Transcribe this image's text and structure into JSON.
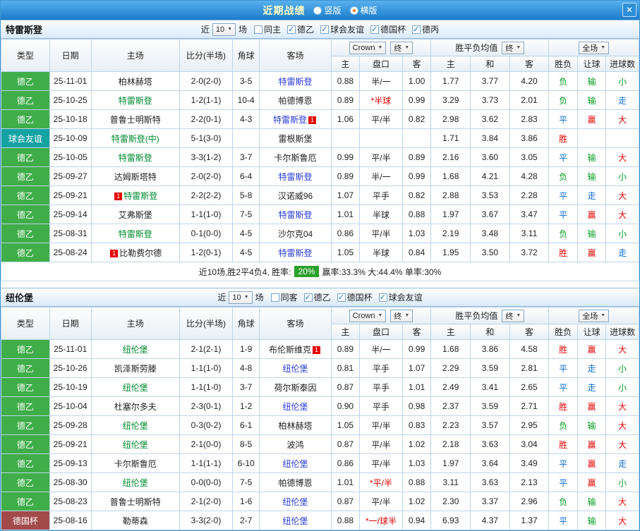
{
  "titlebar": {
    "title": "近期战绩",
    "close": "✕",
    "radios": [
      {
        "label": "竖版",
        "selected": false
      },
      {
        "label": "横版",
        "selected": true
      }
    ]
  },
  "columns": {
    "type": "类型",
    "date": "日期",
    "home": "主场",
    "score": "比分(半场)",
    "corner": "角球",
    "away": "客场",
    "book_select": "Crown",
    "final_select": "终",
    "asia_home": "主",
    "asia_handicap": "盘口",
    "asia_away": "客",
    "europe_label": "胜平负均值",
    "eu_home": "主",
    "eu_draw": "和",
    "eu_away": "客",
    "scope_select": "全场",
    "res_wdl": "胜负",
    "res_handicap": "让球",
    "res_goals": "进球数"
  },
  "sections": [
    {
      "team": "特雷斯登",
      "filter": {
        "prefix": "近",
        "count": "10",
        "suffix": "场",
        "checks": [
          {
            "label": "同主",
            "checked": false
          },
          {
            "label": "德乙",
            "checked": true
          },
          {
            "label": "球会友谊",
            "checked": true
          },
          {
            "label": "德国杯",
            "checked": true
          },
          {
            "label": "德丙",
            "checked": true
          }
        ]
      },
      "rows": [
        {
          "type": "德乙",
          "type_color": "bg-green",
          "date": "25-11-01",
          "home": "柏林赫塔",
          "home_color": "c-dark",
          "home_badge": "",
          "score": "2-0(2-0)",
          "corner": "3-5",
          "away": "特雷斯登",
          "away_color": "c-away",
          "away_badge": "",
          "a1": "0.88",
          "ah": "半/一",
          "ah_color": "",
          "a2": "1.00",
          "e1": "1.77",
          "e2": "3.77",
          "e3": "4.20",
          "r1": "负",
          "r1c": "c-green",
          "r2": "输",
          "r2c": "c-green",
          "r3": "小",
          "r3c": "c-green"
        },
        {
          "type": "德乙",
          "type_color": "bg-green",
          "date": "25-10-25",
          "home": "特雷斯登",
          "home_color": "c-home",
          "home_badge": "",
          "score": "1-2(1-1)",
          "corner": "10-4",
          "away": "帕德博恩",
          "away_color": "c-dark",
          "away_badge": "",
          "a1": "0.89",
          "ah": "*半球",
          "ah_color": "c-red",
          "a2": "0.99",
          "e1": "3.29",
          "e2": "3.73",
          "e3": "2.01",
          "r1": "负",
          "r1c": "c-green",
          "r2": "输",
          "r2c": "c-green",
          "r3": "走",
          "r3c": "c-blue"
        },
        {
          "type": "德乙",
          "type_color": "bg-green",
          "date": "25-10-18",
          "home": "普鲁士明斯特",
          "home_color": "c-dark",
          "home_badge": "",
          "score": "2-2(0-1)",
          "corner": "4-3",
          "away": "特雷斯登",
          "away_color": "c-away",
          "away_badge": "1",
          "a1": "1.06",
          "ah": "平/半",
          "ah_color": "",
          "a2": "0.82",
          "e1": "2.98",
          "e2": "3.62",
          "e3": "2.83",
          "r1": "平",
          "r1c": "c-blue",
          "r2": "赢",
          "r2c": "c-red",
          "r3": "大",
          "r3c": "c-red"
        },
        {
          "type": "球会友谊",
          "type_color": "bg-teal",
          "date": "25-10-09",
          "home": "特雷斯登(中)",
          "home_color": "c-home",
          "home_badge": "",
          "score": "5-1(3-0)",
          "corner": "",
          "away": "雷根斯堡",
          "away_color": "c-dark",
          "away_badge": "",
          "a1": "",
          "ah": "",
          "ah_color": "",
          "a2": "",
          "e1": "1.71",
          "e2": "3.84",
          "e3": "3.86",
          "r1": "胜",
          "r1c": "c-red",
          "r2": "",
          "r2c": "",
          "r3": "",
          "r3c": ""
        },
        {
          "type": "德乙",
          "type_color": "bg-green",
          "date": "25-10-05",
          "home": "特雷斯登",
          "home_color": "c-home",
          "home_badge": "",
          "score": "3-3(1-2)",
          "corner": "3-7",
          "away": "卡尔斯鲁厄",
          "away_color": "c-dark",
          "away_badge": "",
          "a1": "0.99",
          "ah": "平/半",
          "ah_color": "",
          "a2": "0.89",
          "e1": "2.16",
          "e2": "3.60",
          "e3": "3.05",
          "r1": "平",
          "r1c": "c-blue",
          "r2": "输",
          "r2c": "c-green",
          "r3": "大",
          "r3c": "c-red"
        },
        {
          "type": "德乙",
          "type_color": "bg-green",
          "date": "25-09-27",
          "home": "达姆斯塔特",
          "home_color": "c-dark",
          "home_badge": "",
          "score": "2-0(2-0)",
          "corner": "6-4",
          "away": "特雷斯登",
          "away_color": "c-away",
          "away_badge": "",
          "a1": "0.89",
          "ah": "半/一",
          "ah_color": "",
          "a2": "0.99",
          "e1": "1.68",
          "e2": "4.21",
          "e3": "4.28",
          "r1": "负",
          "r1c": "c-green",
          "r2": "输",
          "r2c": "c-green",
          "r3": "小",
          "r3c": "c-green"
        },
        {
          "type": "德乙",
          "type_color": "bg-green",
          "date": "25-09-21",
          "home": "特雷斯登",
          "home_color": "c-home",
          "home_badge": "1",
          "score": "2-2(2-2)",
          "corner": "5-8",
          "away": "汉诺威96",
          "away_color": "c-dark",
          "away_badge": "",
          "a1": "1.07",
          "ah": "平手",
          "ah_color": "",
          "a2": "0.82",
          "e1": "2.88",
          "e2": "3.53",
          "e3": "2.28",
          "r1": "平",
          "r1c": "c-blue",
          "r2": "走",
          "r2c": "c-blue",
          "r3": "大",
          "r3c": "c-red"
        },
        {
          "type": "德乙",
          "type_color": "bg-green",
          "date": "25-09-14",
          "home": "艾弗斯堡",
          "home_color": "c-dark",
          "home_badge": "",
          "score": "1-1(1-0)",
          "corner": "7-5",
          "away": "特雷斯登",
          "away_color": "c-away",
          "away_badge": "",
          "a1": "1.01",
          "ah": "半球",
          "ah_color": "",
          "a2": "0.88",
          "e1": "1.97",
          "e2": "3.67",
          "e3": "3.47",
          "r1": "平",
          "r1c": "c-blue",
          "r2": "赢",
          "r2c": "c-red",
          "r3": "大",
          "r3c": "c-red"
        },
        {
          "type": "德乙",
          "type_color": "bg-green",
          "date": "25-08-31",
          "home": "特雷斯登",
          "home_color": "c-home",
          "home_badge": "",
          "score": "0-1(0-0)",
          "corner": "4-5",
          "away": "沙尔克04",
          "away_color": "c-dark",
          "away_badge": "",
          "a1": "0.86",
          "ah": "平/半",
          "ah_color": "",
          "a2": "1.03",
          "e1": "2.19",
          "e2": "3.48",
          "e3": "3.11",
          "r1": "负",
          "r1c": "c-green",
          "r2": "输",
          "r2c": "c-green",
          "r3": "小",
          "r3c": "c-green"
        },
        {
          "type": "德乙",
          "type_color": "bg-green",
          "date": "25-08-24",
          "home": "比勒费尔德",
          "home_color": "c-dark",
          "home_badge": "1",
          "score": "1-2(0-1)",
          "corner": "4-5",
          "away": "特雷斯登",
          "away_color": "c-away",
          "away_badge": "",
          "a1": "1.05",
          "ah": "半球",
          "ah_color": "",
          "a2": "0.84",
          "e1": "1.95",
          "e2": "3.50",
          "e3": "3.72",
          "r1": "胜",
          "r1c": "c-red",
          "r2": "赢",
          "r2c": "c-red",
          "r3": "走",
          "r3c": "c-blue"
        }
      ],
      "summary": {
        "lead": "近10场,胜2平4负4, 胜率:",
        "badge": "20%",
        "tail": "赢率:33.3% 大:44.4% 单率:30%"
      }
    },
    {
      "team": "纽伦堡",
      "filter": {
        "prefix": "近",
        "count": "10",
        "suffix": "场",
        "checks": [
          {
            "label": "同客",
            "checked": false
          },
          {
            "label": "德乙",
            "checked": true
          },
          {
            "label": "德国杯",
            "checked": true
          },
          {
            "label": "球会友谊",
            "checked": true
          }
        ]
      },
      "rows": [
        {
          "type": "德乙",
          "type_color": "bg-green",
          "date": "25-11-01",
          "home": "纽伦堡",
          "home_color": "c-home",
          "home_badge": "",
          "score": "2-1(2-1)",
          "corner": "1-9",
          "away": "布伦斯维克",
          "away_color": "c-dark",
          "away_badge": "1",
          "a1": "0.89",
          "ah": "半/一",
          "ah_color": "",
          "a2": "0.99",
          "e1": "1.68",
          "e2": "3.86",
          "e3": "4.58",
          "r1": "胜",
          "r1c": "c-red",
          "r2": "赢",
          "r2c": "c-red",
          "r3": "大",
          "r3c": "c-red"
        },
        {
          "type": "德乙",
          "type_color": "bg-green",
          "date": "25-10-26",
          "home": "凯泽斯劳滕",
          "home_color": "c-dark",
          "home_badge": "",
          "score": "1-1(1-0)",
          "corner": "4-8",
          "away": "纽伦堡",
          "away_color": "c-away",
          "away_badge": "",
          "a1": "0.81",
          "ah": "平手",
          "ah_color": "",
          "a2": "1.07",
          "e1": "2.29",
          "e2": "3.59",
          "e3": "2.81",
          "r1": "平",
          "r1c": "c-blue",
          "r2": "走",
          "r2c": "c-blue",
          "r3": "小",
          "r3c": "c-green"
        },
        {
          "type": "德乙",
          "type_color": "bg-green",
          "date": "25-10-19",
          "home": "纽伦堡",
          "home_color": "c-home",
          "home_badge": "",
          "score": "1-1(1-0)",
          "corner": "3-7",
          "away": "荷尔斯泰因",
          "away_color": "c-dark",
          "away_badge": "",
          "a1": "0.87",
          "ah": "平手",
          "ah_color": "",
          "a2": "1.01",
          "e1": "2.49",
          "e2": "3.41",
          "e3": "2.65",
          "r1": "平",
          "r1c": "c-blue",
          "r2": "走",
          "r2c": "c-blue",
          "r3": "小",
          "r3c": "c-green"
        },
        {
          "type": "德乙",
          "type_color": "bg-green",
          "date": "25-10-04",
          "home": "杜塞尔多夫",
          "home_color": "c-dark",
          "home_badge": "",
          "score": "2-3(0-1)",
          "corner": "1-2",
          "away": "纽伦堡",
          "away_color": "c-away",
          "away_badge": "",
          "a1": "0.90",
          "ah": "平手",
          "ah_color": "",
          "a2": "0.98",
          "e1": "2.37",
          "e2": "3.59",
          "e3": "2.71",
          "r1": "胜",
          "r1c": "c-red",
          "r2": "赢",
          "r2c": "c-red",
          "r3": "大",
          "r3c": "c-red"
        },
        {
          "type": "德乙",
          "type_color": "bg-green",
          "date": "25-09-28",
          "home": "纽伦堡",
          "home_color": "c-home",
          "home_badge": "",
          "score": "0-3(0-2)",
          "corner": "6-1",
          "away": "柏林赫塔",
          "away_color": "c-dark",
          "away_badge": "",
          "a1": "1.05",
          "ah": "平/半",
          "ah_color": "",
          "a2": "0.83",
          "e1": "2.23",
          "e2": "3.57",
          "e3": "2.95",
          "r1": "负",
          "r1c": "c-green",
          "r2": "输",
          "r2c": "c-green",
          "r3": "大",
          "r3c": "c-red"
        },
        {
          "type": "德乙",
          "type_color": "bg-green",
          "date": "25-09-21",
          "home": "纽伦堡",
          "home_color": "c-home",
          "home_badge": "",
          "score": "2-1(0-0)",
          "corner": "8-5",
          "away": "波鸿",
          "away_color": "c-dark",
          "away_badge": "",
          "a1": "0.87",
          "ah": "平/半",
          "ah_color": "",
          "a2": "1.02",
          "e1": "2.18",
          "e2": "3.63",
          "e3": "3.04",
          "r1": "胜",
          "r1c": "c-red",
          "r2": "赢",
          "r2c": "c-red",
          "r3": "大",
          "r3c": "c-red"
        },
        {
          "type": "德乙",
          "type_color": "bg-green",
          "date": "25-09-13",
          "home": "卡尔斯鲁厄",
          "home_color": "c-dark",
          "home_badge": "",
          "score": "1-1(1-1)",
          "corner": "6-10",
          "away": "纽伦堡",
          "away_color": "c-away",
          "away_badge": "",
          "a1": "0.86",
          "ah": "平/半",
          "ah_color": "",
          "a2": "1.03",
          "e1": "1.97",
          "e2": "3.64",
          "e3": "3.49",
          "r1": "平",
          "r1c": "c-blue",
          "r2": "赢",
          "r2c": "c-red",
          "r3": "走",
          "r3c": "c-blue"
        },
        {
          "type": "德乙",
          "type_color": "bg-green",
          "date": "25-08-30",
          "home": "纽伦堡",
          "home_color": "c-home",
          "home_badge": "",
          "score": "0-0(0-0)",
          "corner": "7-5",
          "away": "帕德博恩",
          "away_color": "c-dark",
          "away_badge": "",
          "a1": "1.01",
          "ah": "*平/半",
          "ah_color": "c-red",
          "a2": "0.88",
          "e1": "3.11",
          "e2": "3.63",
          "e3": "2.13",
          "r1": "平",
          "r1c": "c-blue",
          "r2": "赢",
          "r2c": "c-red",
          "r3": "小",
          "r3c": "c-green"
        },
        {
          "type": "德乙",
          "type_color": "bg-green",
          "date": "25-08-23",
          "home": "普鲁士明斯特",
          "home_color": "c-dark",
          "home_badge": "",
          "score": "2-1(2-0)",
          "corner": "1-6",
          "away": "纽伦堡",
          "away_color": "c-away",
          "away_badge": "",
          "a1": "0.87",
          "ah": "平/半",
          "ah_color": "",
          "a2": "1.02",
          "e1": "2.30",
          "e2": "3.37",
          "e3": "2.96",
          "r1": "负",
          "r1c": "c-green",
          "r2": "输",
          "r2c": "c-green",
          "r3": "大",
          "r3c": "c-red"
        },
        {
          "type": "德国杯",
          "type_color": "bg-maroon",
          "date": "25-08-16",
          "home": "勒蒂森",
          "home_color": "c-dark",
          "home_badge": "",
          "score": "3-3(2-0)",
          "corner": "2-7",
          "away": "纽伦堡",
          "away_color": "c-away",
          "away_badge": "",
          "a1": "0.88",
          "ah": "*一/球半",
          "ah_color": "c-red",
          "a2": "0.94",
          "e1": "6.93",
          "e2": "4.37",
          "e3": "1.37",
          "r1": "平",
          "r1c": "c-blue",
          "r2": "输",
          "r2c": "c-green",
          "r3": "大",
          "r3c": "c-red"
        }
      ]
    }
  ]
}
